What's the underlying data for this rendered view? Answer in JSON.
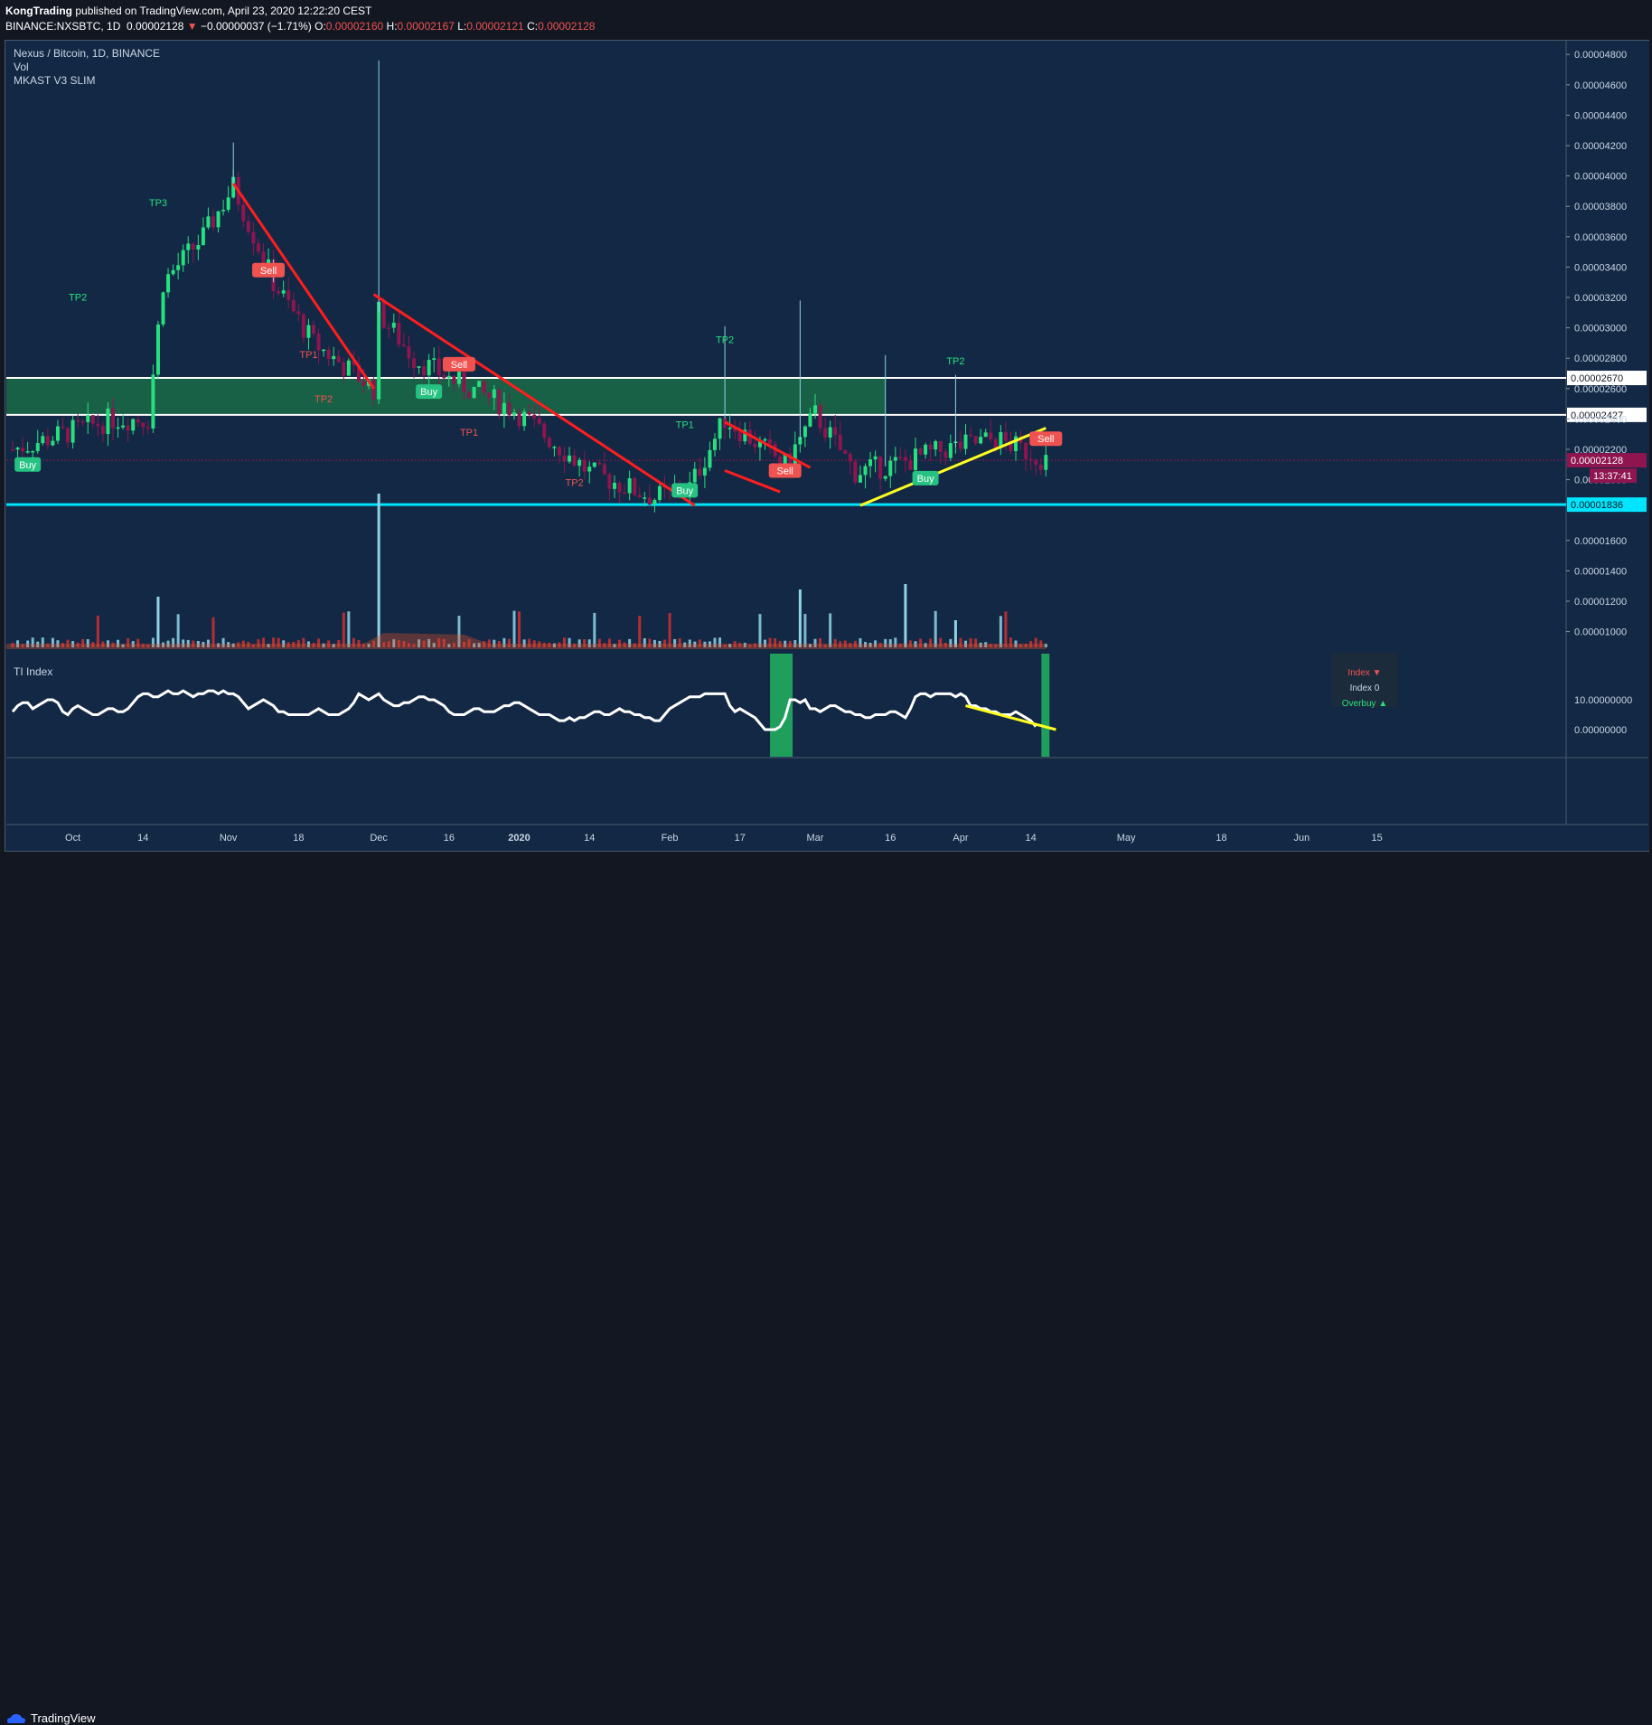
{
  "header": {
    "author": "KongTrading",
    "published_text": "published on TradingView.com, April 23, 2020 12:22:20 CEST",
    "symbol": "BINANCE:NXSBTC, 1D",
    "last": "0.00002128",
    "change": "−0.00000037 (−1.71%)",
    "o_label": "O:",
    "o_value": "0.00002160",
    "h_label": "H:",
    "h_value": "0.00002167",
    "l_label": "L:",
    "l_value": "0.00002121",
    "c_label": "C:",
    "c_value": "0.00002128"
  },
  "legend": {
    "pair": "Nexus / Bitcoin, 1D, BINANCE",
    "vol": "Vol",
    "indicator": "MKAST V3 SLIM",
    "sub_indicator": "TI Index"
  },
  "footer": {
    "brand": "TradingView"
  },
  "popup": {
    "line1": "Index ▼",
    "line2": "Index 0",
    "line3": "Overbuy ▲"
  },
  "colors": {
    "background": "#132844",
    "bull": "#26e07f",
    "bear": "#8e1550",
    "trend": "#ff1e1e",
    "support": "#00e5ff",
    "yellow_trend": "#ffff20",
    "zone": "#1b6b46"
  },
  "chart_data": {
    "type": "candlestick",
    "title": "Nexus / Bitcoin, 1D, BINANCE",
    "y_axis": {
      "min": 9e-07,
      "max": 4.9e-06,
      "ticks": [
        "0.00004800",
        "0.00004600",
        "0.00004400",
        "0.00004200",
        "0.00004000",
        "0.00003800",
        "0.00003600",
        "0.00003400",
        "0.00003200",
        "0.00003000",
        "0.00002800",
        "0.00002600",
        "0.00002400",
        "0.00002200",
        "0.00002000",
        "0.00001600",
        "0.00001400",
        "0.00001200",
        "0.00001000"
      ],
      "tick_values": [
        48,
        46,
        44,
        42,
        40,
        38,
        36,
        34,
        32,
        30,
        28,
        26,
        24,
        22,
        20,
        16,
        14,
        12,
        10
      ]
    },
    "x_axis": {
      "labels": [
        "Oct",
        "14",
        "Nov",
        "18",
        "Dec",
        "16",
        "2020",
        "14",
        "Feb",
        "17",
        "Mar",
        "16",
        "Apr",
        "14",
        "May",
        "18",
        "Jun",
        "15"
      ],
      "label_days": [
        12,
        26,
        43,
        57,
        73,
        87,
        101,
        115,
        131,
        145,
        160,
        175,
        189,
        203,
        222,
        241,
        257,
        272
      ]
    },
    "price_levels": [
      {
        "value": "0.00002670",
        "v": 26.7,
        "style": "white"
      },
      {
        "value": "0.00002427",
        "v": 24.27,
        "style": "white"
      },
      {
        "value": "0.00001836",
        "v": 18.36,
        "style": "cyan"
      }
    ],
    "last_price_label": "0.00002128",
    "last_price_v": 21.28,
    "countdown": "13:37:41",
    "zone": {
      "from_day": 0,
      "to_day": 174,
      "low": 24.27,
      "high": 26.7
    },
    "signals": [
      {
        "text": "Buy",
        "day": 3,
        "v": 21.0,
        "kind": "buy"
      },
      {
        "text": "TP2",
        "day": 13,
        "v": 31.8,
        "kind": "tp-up"
      },
      {
        "text": "TP3",
        "day": 29,
        "v": 38.0,
        "kind": "tp-up"
      },
      {
        "text": "Sell",
        "day": 51,
        "v": 33.8,
        "kind": "sell"
      },
      {
        "text": "TP1",
        "day": 59,
        "v": 28.0,
        "kind": "tp-down"
      },
      {
        "text": "TP2",
        "day": 62,
        "v": 25.1,
        "kind": "tp-down"
      },
      {
        "text": "Buy",
        "day": 83,
        "v": 25.8,
        "kind": "buy"
      },
      {
        "text": "Sell",
        "day": 89,
        "v": 27.6,
        "kind": "sell"
      },
      {
        "text": "TP1",
        "day": 91,
        "v": 22.9,
        "kind": "tp-down"
      },
      {
        "text": "TP2",
        "day": 112,
        "v": 19.6,
        "kind": "tp-down"
      },
      {
        "text": "Buy",
        "day": 134,
        "v": 19.3,
        "kind": "buy"
      },
      {
        "text": "TP1",
        "day": 134,
        "v": 23.4,
        "kind": "tp-up"
      },
      {
        "text": "TP2",
        "day": 142,
        "v": 29.0,
        "kind": "tp-up"
      },
      {
        "text": "Sell",
        "day": 154,
        "v": 20.6,
        "kind": "sell"
      },
      {
        "text": "Buy",
        "day": 182,
        "v": 20.1,
        "kind": "buy"
      },
      {
        "text": "TP2",
        "day": 188,
        "v": 27.6,
        "kind": "tp-up"
      },
      {
        "text": "Sell",
        "day": 206,
        "v": 22.7,
        "kind": "sell"
      }
    ],
    "trendlines": [
      {
        "color": "red",
        "from": [
          44,
          39.5
        ],
        "to": [
          72,
          26.0
        ]
      },
      {
        "color": "red",
        "from": [
          72,
          32.2
        ],
        "to": [
          136,
          18.3
        ]
      },
      {
        "color": "red",
        "from": [
          142,
          23.8
        ],
        "to": [
          159,
          20.8
        ]
      },
      {
        "color": "red",
        "from": [
          142,
          20.6
        ],
        "to": [
          153,
          19.2
        ]
      },
      {
        "color": "yellow",
        "from": [
          169,
          18.3
        ],
        "to": [
          206,
          23.4
        ]
      }
    ],
    "sub_axis": {
      "ticks": [
        "10.00000000",
        "0.00000000"
      ],
      "tick_values": [
        10,
        0
      ]
    },
    "sub_series": [
      6,
      8,
      9,
      9,
      7,
      8,
      9,
      10,
      10,
      9,
      6,
      5,
      7,
      8,
      7,
      6,
      5,
      5,
      6,
      7,
      7,
      6,
      6,
      7,
      9,
      11,
      12,
      12,
      11,
      11,
      12,
      13,
      12,
      12,
      13,
      12,
      11,
      12,
      12,
      13,
      13,
      12,
      13,
      12,
      12,
      11,
      9,
      7,
      8,
      9,
      10,
      9,
      8,
      6,
      6,
      5,
      5,
      5,
      5,
      5,
      6,
      7,
      6,
      5,
      5,
      5,
      6,
      7,
      9,
      12,
      11,
      10,
      11,
      12,
      10,
      9,
      8,
      8,
      9,
      9,
      10,
      11,
      11,
      10,
      10,
      9,
      8,
      6,
      5,
      5,
      5,
      6,
      7,
      7,
      6,
      6,
      6,
      7,
      8,
      8,
      9,
      9,
      8,
      7,
      6,
      5,
      5,
      5,
      4,
      3,
      3,
      4,
      3,
      4,
      4,
      5,
      6,
      6,
      5,
      5,
      6,
      7,
      6,
      6,
      5,
      5,
      4,
      4,
      3,
      3,
      5,
      7,
      8,
      9,
      10,
      11,
      11,
      11,
      12,
      12,
      12,
      12,
      12,
      8,
      6,
      7,
      6,
      5,
      4,
      2,
      0,
      0,
      0,
      1,
      4,
      10,
      10,
      9,
      10,
      7,
      7,
      6,
      7,
      8,
      8,
      7,
      6,
      6,
      5,
      5,
      4,
      4,
      5,
      5,
      5,
      6,
      6,
      5,
      4,
      7,
      11,
      12,
      12,
      11,
      12,
      12,
      12,
      12,
      11,
      12,
      11,
      8,
      8,
      7,
      7,
      6,
      6,
      5,
      5,
      5,
      6,
      5,
      4,
      3,
      1
    ]
  }
}
